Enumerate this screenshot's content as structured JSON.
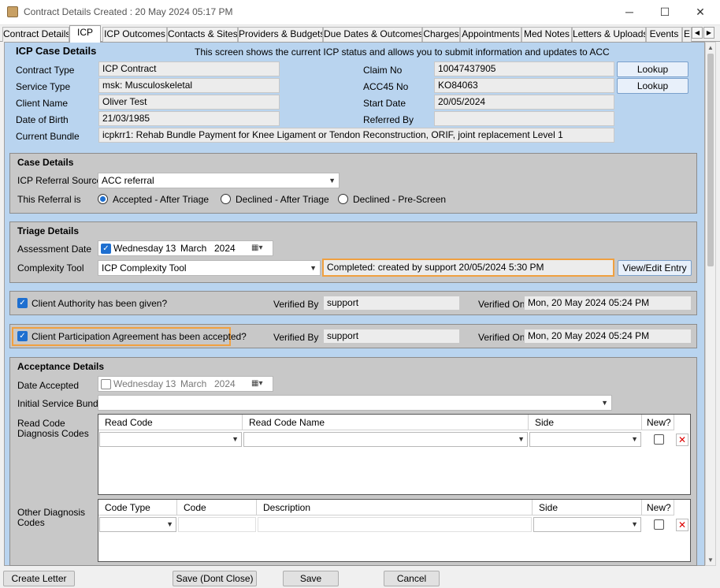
{
  "window": {
    "title": "Contract Details Created : 20 May 2024 05:17 PM",
    "minimize": "─",
    "maximize": "☐",
    "close": "✕"
  },
  "tabs": [
    "Contract Details",
    "ICP",
    "ICP Outcomes",
    "Contacts & Sites",
    "Providers & Budgets",
    "Due Dates & Outcomes",
    "Charges",
    "Appointments",
    "Med Notes",
    "Letters & Uploads",
    "Events",
    "E"
  ],
  "active_tab": "ICP",
  "header": {
    "title": "ICP Case Details",
    "description": "This screen shows the current ICP status and allows you to submit information and updates to ACC",
    "contract_type_label": "Contract Type",
    "contract_type": "ICP Contract",
    "service_type_label": "Service Type",
    "service_type": "msk: Musculoskeletal",
    "client_name_label": "Client Name",
    "client_name": "Oliver Test",
    "dob_label": "Date of Birth",
    "dob": "21/03/1985",
    "bundle_label": "Current Bundle",
    "bundle": "icpkrr1: Rehab Bundle Payment for Knee Ligament or Tendon Reconstruction, ORIF, joint replacement Level 1",
    "claim_no_label": "Claim No",
    "claim_no": "10047437905",
    "acc45_label": "ACC45 No",
    "acc45": "KO84063",
    "start_date_label": "Start Date",
    "start_date": "20/05/2024",
    "referred_by_label": "Referred By",
    "referred_by": "",
    "lookup_label": "Lookup"
  },
  "case_details": {
    "title": "Case Details",
    "referral_source_label": "ICP Referral Source",
    "referral_source": "ACC referral",
    "referral_is_label": "This Referral is",
    "options": [
      "Accepted - After Triage",
      "Declined - After Triage",
      "Declined - Pre-Screen"
    ],
    "selected": "Accepted - After Triage"
  },
  "triage": {
    "title": "Triage Details",
    "assessment_date_label": "Assessment Date",
    "assessment_day": "Wednesday",
    "assessment_dd": "13",
    "assessment_month": "March",
    "assessment_year": "2024",
    "complexity_tool_label": "Complexity Tool",
    "complexity_tool": "ICP Complexity Tool",
    "status": "Completed:  created by support 20/05/2024 5:30 PM",
    "view_edit_label": "View/Edit Entry"
  },
  "authority": {
    "label": "Client Authority has been given?",
    "verified_by_label": "Verified By",
    "verified_by": "support",
    "verified_on_label": "Verified On",
    "verified_on": "Mon, 20 May 2024 05:24 PM"
  },
  "participation": {
    "label": "Client Participation Agreement has been accepted?",
    "verified_by_label": "Verified By",
    "verified_by": "support",
    "verified_on_label": "Verified On",
    "verified_on": "Mon, 20 May 2024 05:24 PM"
  },
  "acceptance": {
    "title": "Acceptance Details",
    "date_accepted_label": "Date Accepted",
    "day": "Wednesday",
    "dd": "13",
    "month": "March",
    "year": "2024",
    "bundle_label": "Initial Service Bundle",
    "read_code_label_1": "Read Code",
    "read_code_label_2": "Diagnosis Codes",
    "read_code_cols": [
      "Read Code",
      "Read Code Name",
      "Side",
      "New?"
    ],
    "other_label_1": "Other Diagnosis",
    "other_label_2": "Codes",
    "other_cols": [
      "Code Type",
      "Code",
      "Description",
      "Side",
      "New?"
    ]
  },
  "footer": {
    "create_letter": "Create Letter",
    "save_dont_close": "Save (Dont Close)",
    "save": "Save",
    "cancel": "Cancel"
  },
  "colors": {
    "background": "#b9d4ef",
    "panel": "#c8c8c8",
    "highlight": "#f0a040",
    "accent": "#1e6fd0"
  }
}
